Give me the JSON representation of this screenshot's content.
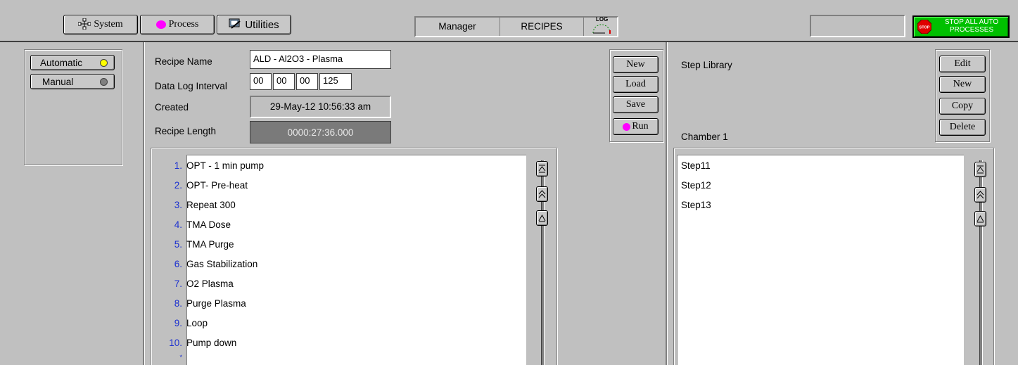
{
  "top_bar": {
    "system_label": "System",
    "process_label": "Process",
    "utilities_label": "Utilities",
    "user_label": "Manager",
    "screen_label": "RECIPES",
    "log_label": "LOG",
    "stop_icon_text": "STOP",
    "stop_label": "STOP ALL AUTO PROCESSES"
  },
  "mode": {
    "automatic_label": "Automatic",
    "manual_label": "Manual",
    "automatic_indicator_color": "#ffff00",
    "manual_indicator_color": "#808080"
  },
  "recipe": {
    "name_label": "Recipe Name",
    "name_value": "ALD - Al2O3 - Plasma",
    "log_interval_label": "Data Log Interval",
    "log_interval": [
      "00",
      "00",
      "00",
      "125"
    ],
    "created_label": "Created",
    "created_value": "29-May-12  10:56:33 am",
    "length_label": "Recipe Length",
    "length_value": "0000:27:36.000"
  },
  "recipe_buttons": {
    "new": "New",
    "load": "Load",
    "save": "Save",
    "run": "Run"
  },
  "steps": [
    {
      "num": "1.",
      "name": "OPT - 1 min pump"
    },
    {
      "num": "2.",
      "name": "OPT- Pre-heat"
    },
    {
      "num": "3.",
      "name": "Repeat  300"
    },
    {
      "num": "4.",
      "name": "TMA Dose"
    },
    {
      "num": "5.",
      "name": "TMA Purge"
    },
    {
      "num": "6.",
      "name": "Gas Stabilization"
    },
    {
      "num": "7.",
      "name": "O2 Plasma"
    },
    {
      "num": "8.",
      "name": "Purge Plasma"
    },
    {
      "num": "9.",
      "name": "Loop"
    },
    {
      "num": "10.",
      "name": "Pump down"
    },
    {
      "num": "*",
      "name": ""
    }
  ],
  "library": {
    "title": "Step Library",
    "chamber_label": "Chamber 1",
    "edit": "Edit",
    "new": "New",
    "copy": "Copy",
    "delete": "Delete",
    "items": [
      "Step11",
      "Step12",
      "Step13"
    ]
  },
  "colors": {
    "process_dot": "#ff00ff",
    "stop_button_bg": "#00c000",
    "length_field_bg": "#7a7a7a"
  }
}
